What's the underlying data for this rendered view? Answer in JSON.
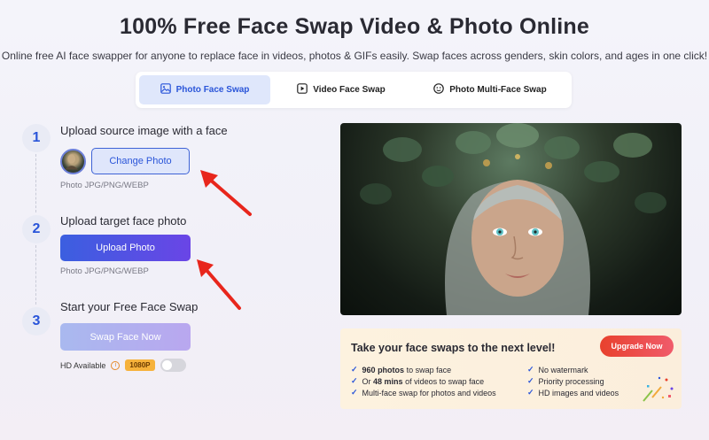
{
  "header": {
    "title": "100% Free Face Swap Video & Photo Online",
    "subtitle": "Online free AI face swapper for anyone to replace face in videos, photos & GIFs easily. Swap faces across genders, skin colors, and ages in one click!"
  },
  "tabs": [
    {
      "label": "Photo Face Swap",
      "icon": "image-icon",
      "active": true
    },
    {
      "label": "Video Face Swap",
      "icon": "video-icon",
      "active": false
    },
    {
      "label": "Photo Multi-Face Swap",
      "icon": "multi-face-icon",
      "active": false
    }
  ],
  "steps": [
    {
      "number": "1",
      "title": "Upload source image with a face",
      "button": "Change Photo",
      "hint": "Photo JPG/PNG/WEBP"
    },
    {
      "number": "2",
      "title": "Upload target face photo",
      "button": "Upload Photo",
      "hint": "Photo JPG/PNG/WEBP"
    },
    {
      "number": "3",
      "title": "Start your Free Face Swap",
      "button": "Swap Face Now"
    }
  ],
  "hd": {
    "label": "HD Available",
    "badge": "1080P"
  },
  "promo": {
    "title": "Take your face swaps to the next level!",
    "button": "Upgrade Now",
    "features_left": [
      {
        "bold": "960 photos",
        "rest": " to swap face",
        "prefix": ""
      },
      {
        "prefix": "Or ",
        "bold": "48 mins",
        "rest": " of videos to swap face"
      },
      {
        "prefix": "",
        "bold": "",
        "rest": "Multi-face swap for photos and videos"
      }
    ],
    "features_right": [
      "No watermark",
      "Priority processing",
      "HD images and videos"
    ]
  },
  "colors": {
    "accent": "#2a55d9",
    "upgrade": "#e8412d",
    "annotation": "#e8261c"
  }
}
